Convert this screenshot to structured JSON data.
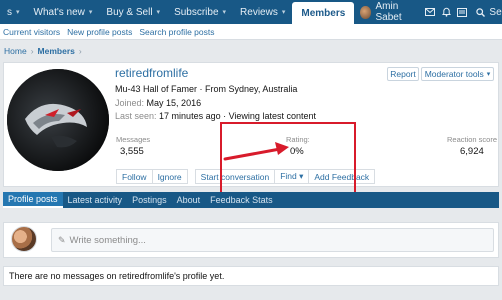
{
  "nav": {
    "tabs": [
      {
        "label": "s",
        "caret": "▾"
      },
      {
        "label": "What's new",
        "caret": "▾"
      },
      {
        "label": "Buy & Sell",
        "caret": "▾"
      },
      {
        "label": "Subscribe",
        "caret": "▾"
      },
      {
        "label": "Reviews",
        "caret": "▾"
      },
      {
        "label": "Members",
        "caret": ""
      }
    ],
    "user_name": "Amin Sabet",
    "search_label": "Search"
  },
  "subnav": [
    "Current visitors",
    "New profile posts",
    "Search profile posts"
  ],
  "breadcrumb": {
    "home": "Home",
    "sep": "›",
    "current": "Members",
    "sep2": "›"
  },
  "profile": {
    "username": "retiredfromlife",
    "title": "Mu-43 Hall of Famer · From Sydney, Australia",
    "joined_label": "Joined:",
    "joined_value": "May 15, 2016",
    "seen_label": "Last seen:",
    "seen_value": "17 minutes ago · Viewing latest content",
    "report_label": "Report",
    "mod_tools_label": "Moderator tools",
    "stats": {
      "messages_label": "Messages",
      "messages_value": "3,555",
      "rating_label": "Rating:",
      "rating_value": "0%",
      "reaction_label": "Reaction score",
      "reaction_value": "6,924"
    },
    "actions": [
      "Follow",
      "Ignore",
      "Start conversation",
      "Find ▾",
      "Add Feedback"
    ]
  },
  "tabs": [
    "Profile posts",
    "Latest activity",
    "Postings",
    "About",
    "Feedback Stats"
  ],
  "composer": {
    "placeholder": "Write something..."
  },
  "empty_message": "There are no messages on retiredfromlife's profile yet.",
  "colors": {
    "nav": "#185886",
    "link": "#2d6fa3",
    "annotation": "#d81b2b"
  }
}
